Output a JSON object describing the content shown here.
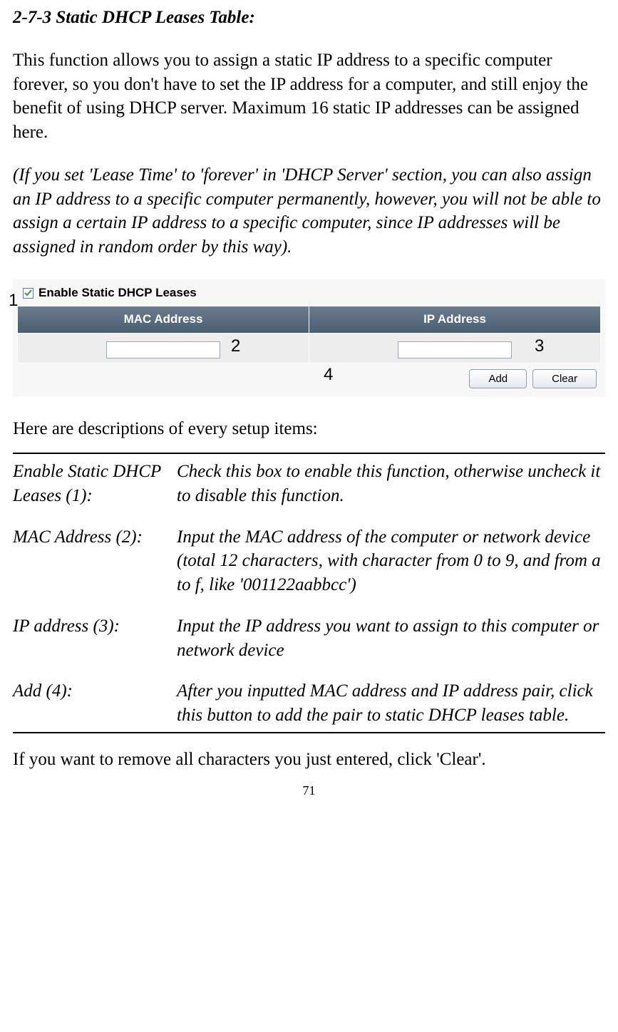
{
  "section_title": "2-7-3 Static DHCP Leases Table:",
  "intro": "This function allows you to assign a static IP address to a specific computer forever, so you don't have to set the IP address for a computer, and still enjoy the benefit of using DHCP server. Maximum 16 static IP addresses can be assigned here.",
  "note": "(If you set 'Lease Time' to 'forever' in 'DHCP Server' section, you can also assign an IP address to a specific computer permanently, however, you will not be able to assign a certain IP address to a specific computer, since IP addresses will be assigned in random order by this way).",
  "ui": {
    "checkbox_label": "Enable Static DHCP Leases",
    "checkbox_checked": true,
    "col_mac": "MAC Address",
    "col_ip": "IP Address",
    "mac_value": "",
    "ip_value": "",
    "btn_add": "Add",
    "btn_clear": "Clear"
  },
  "annotations": {
    "a1": "1",
    "a2": "2",
    "a3": "3",
    "a4": "4"
  },
  "desc_intro": "Here are descriptions of every setup items:",
  "descriptions": {
    "r1_term": "Enable Static DHCP Leases (1):",
    "r1_def": "Check this box to enable this function, otherwise uncheck it to disable this function.",
    "r2_term": "MAC Address (2):",
    "r2_def": "Input the MAC address of the computer or network device (total 12 characters, with character from 0 to 9, and from a to f, like '001122aabbcc')",
    "r3_term": "IP address (3):",
    "r3_def": "Input the IP address you want to assign to this computer or network device",
    "r4_term": "Add (4):",
    "r4_def": "After you inputted MAC address and IP address pair, click this button to add the pair to static DHCP leases table."
  },
  "footer": "If you want to remove all characters you just entered, click 'Clear'.",
  "page_number": "71"
}
